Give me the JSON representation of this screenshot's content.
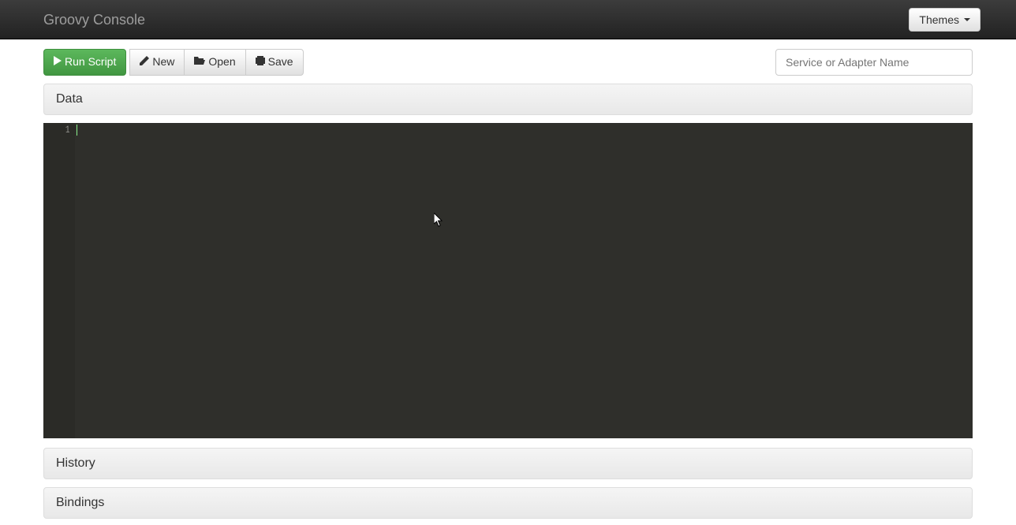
{
  "navbar": {
    "brand": "Groovy Console",
    "themes_label": "Themes"
  },
  "toolbar": {
    "run_label": "Run Script",
    "new_label": "New",
    "open_label": "Open",
    "save_label": "Save"
  },
  "search": {
    "placeholder": "Service or Adapter Name",
    "value": ""
  },
  "panels": {
    "data_label": "Data",
    "history_label": "History",
    "bindings_label": "Bindings"
  },
  "editor": {
    "line_number": "1",
    "content": ""
  }
}
